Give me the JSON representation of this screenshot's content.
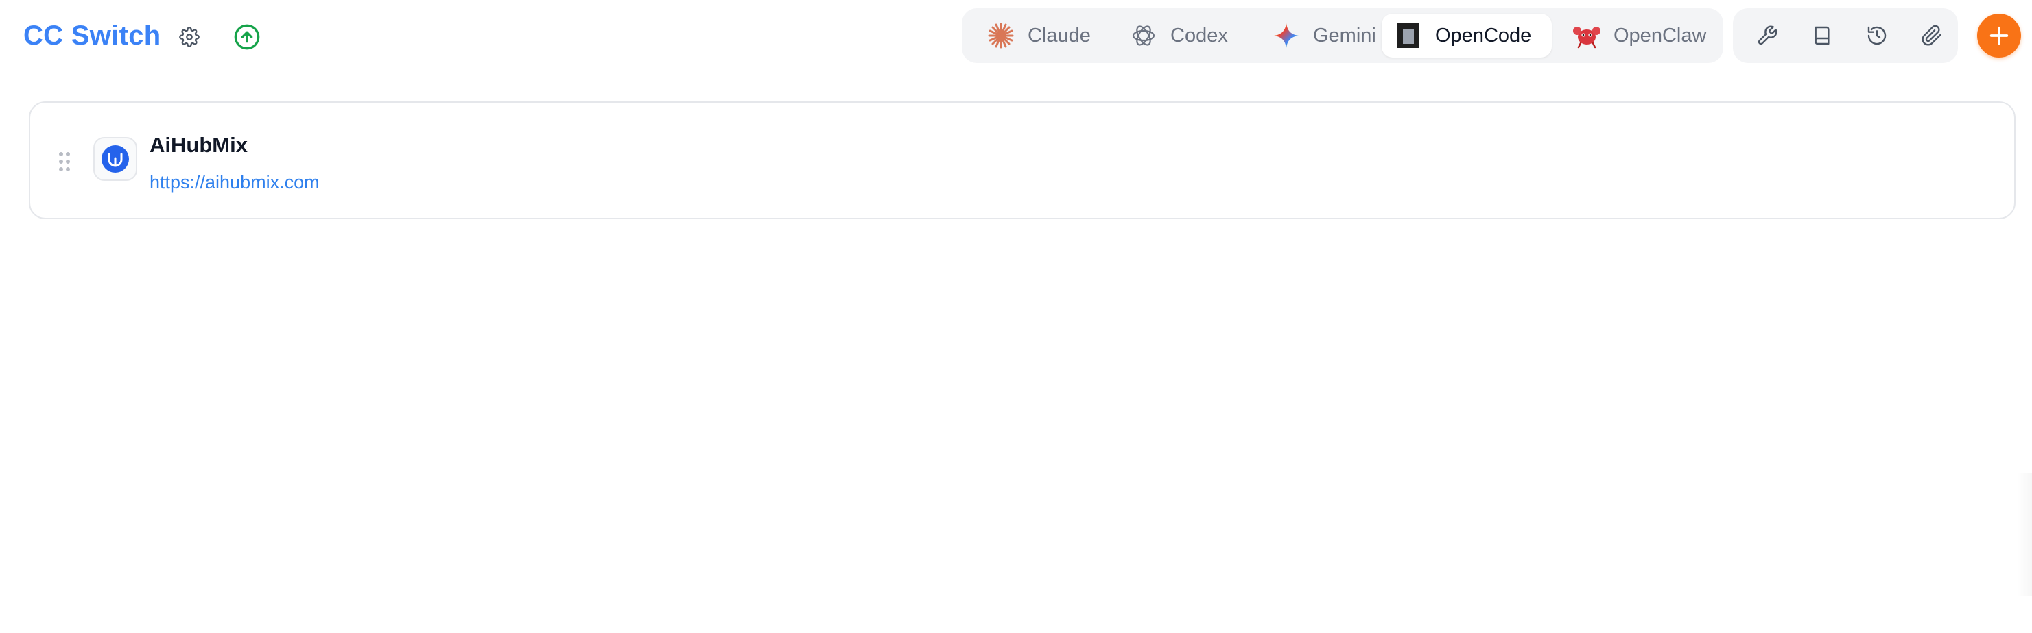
{
  "app": {
    "title": "CC Switch"
  },
  "header": {
    "settings_icon": "gear-icon",
    "update_icon": "arrow-up-circle-icon"
  },
  "app_tabs": [
    {
      "label": "Claude",
      "icon": "claude-starburst-icon",
      "active": false
    },
    {
      "label": "Codex",
      "icon": "codex-knot-icon",
      "active": false
    },
    {
      "label": "Gemini",
      "icon": "gemini-sparkle-icon",
      "active": false
    },
    {
      "label": "OpenCode",
      "icon": "opencode-block-icon",
      "active": true
    },
    {
      "label": "OpenClaw",
      "icon": "openclaw-crab-icon",
      "active": false
    }
  ],
  "toolbar": [
    {
      "icon": "wrench-icon"
    },
    {
      "icon": "book-icon"
    },
    {
      "icon": "history-icon"
    },
    {
      "icon": "paperclip-icon"
    }
  ],
  "add_button": {
    "icon": "plus-icon"
  },
  "providers": [
    {
      "name": "AiHubMix",
      "url": "https://aihubmix.com",
      "logo_icon": "aihubmix-logo-icon"
    }
  ],
  "colors": {
    "brand": "#3b82f6",
    "accent": "#f97316",
    "update": "#16a34a",
    "link": "#2f80ed"
  }
}
